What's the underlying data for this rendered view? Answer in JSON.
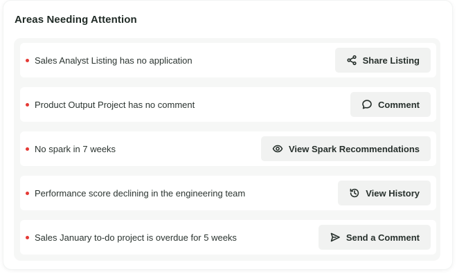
{
  "section": {
    "title": "Areas Needing Attention"
  },
  "colors": {
    "alert_dot": "#e53935",
    "button_bg": "#f1f2f1",
    "panel_bg": "#f6f7f6"
  },
  "items": [
    {
      "text": "Sales Analyst Listing has no application",
      "action_label": "Share Listing",
      "action_icon": "share-icon"
    },
    {
      "text": "Product Output Project has no comment",
      "action_label": "Comment",
      "action_icon": "comment-icon"
    },
    {
      "text": "No spark in 7 weeks",
      "action_label": "View Spark Recommendations",
      "action_icon": "eye-icon"
    },
    {
      "text": "Performance score declining in the engineering team",
      "action_label": "View History",
      "action_icon": "history-icon"
    },
    {
      "text": "Sales January to-do project is overdue for 5 weeks",
      "action_label": "Send a Comment",
      "action_icon": "send-icon"
    }
  ]
}
